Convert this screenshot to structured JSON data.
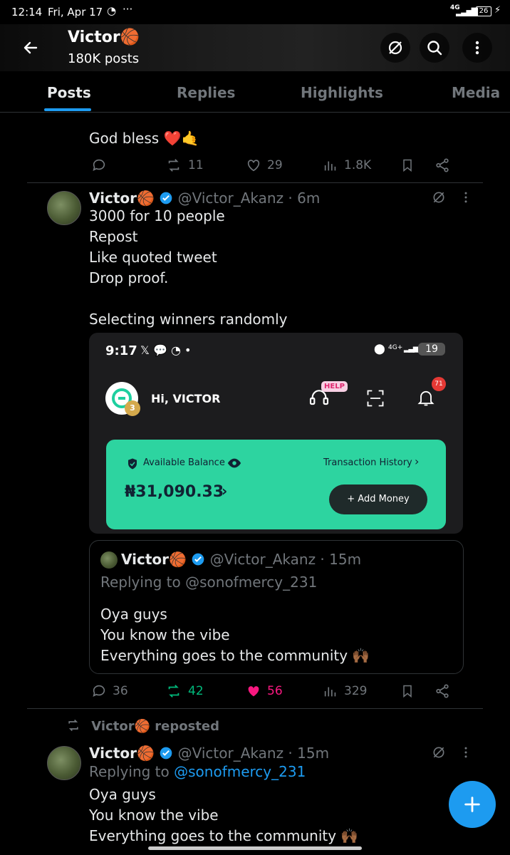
{
  "status_bar": {
    "time": "12:14",
    "date": "Fri, Apr 17",
    "network": "4G",
    "battery": "26"
  },
  "header": {
    "title": "Victor🏀",
    "subtitle": "180K posts"
  },
  "tabs": [
    "Posts",
    "Replies",
    "Highlights",
    "Media"
  ],
  "post0": {
    "text": "God bless ❤️🤙",
    "replies": "",
    "reposts": "11",
    "likes": "29",
    "views": "1.8K"
  },
  "post1": {
    "name": "Victor🏀",
    "handle": "@Victor_Akanz",
    "time": "· 6m",
    "text": "3000 for 10 people\nRepost\nLike quoted tweet\nDrop proof.\n\nSelecting winners randomly",
    "media": {
      "time": "9:17",
      "apps": "𝕏 💬 ◔ •",
      "network": "4G+",
      "battery": "19",
      "greeting": "Hi, VICTOR",
      "badge_level": "3",
      "help_label": "HELP",
      "notif_count": "71",
      "balance_label": "Available Balance",
      "history_label": "Transaction History",
      "balance": "₦31,090.33",
      "add_money": "+ Add Money"
    },
    "quote": {
      "name": "Victor🏀",
      "handle": "@Victor_Akanz",
      "time": "· 15m",
      "replying_to": "Replying to @sonofmercy_231",
      "text": "Oya guys\nYou know the vibe\nEverything goes to the community 🙌🏾"
    },
    "replies": "36",
    "reposts": "42",
    "likes": "56",
    "views": "329",
    "colors": {
      "repost": "#00ba7c",
      "like": "#f91880"
    }
  },
  "post2": {
    "reposted_by": "Victor🏀 reposted",
    "name": "Victor🏀",
    "handle": "@Victor_Akanz",
    "time": "· 15m",
    "replying_prefix": "Replying to ",
    "replying_handle": "@sonofmercy_231",
    "text": "Oya guys\nYou know the vibe\nEverything goes to the community 🙌🏾"
  },
  "colors": {
    "accent": "#1d9bf0",
    "verified": "#1d9bf0",
    "wallet_green": "#2dd4a0"
  }
}
